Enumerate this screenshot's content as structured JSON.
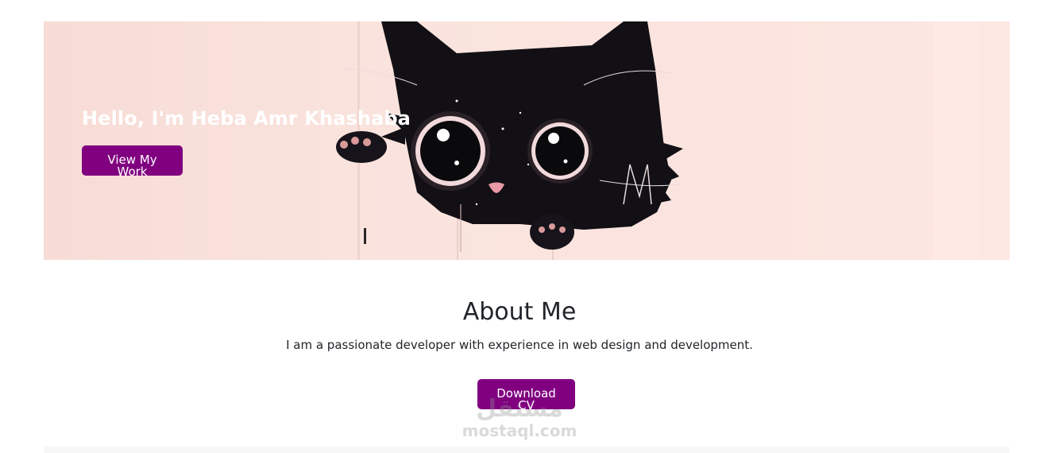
{
  "hero": {
    "title": "Hello, I'm Heba Amr Khashaba",
    "cta_label": "View My Work",
    "illustration": "black-cat-peeking-illustration"
  },
  "about": {
    "heading": "About Me",
    "text": "I am a passionate developer with experience in web design and development.",
    "cv_label": "Download CV"
  },
  "watermark": {
    "arabic": "مستقل",
    "latin": "mostaql.com"
  },
  "colors": {
    "accent": "#800080",
    "hero_bg": "#fbe4df"
  }
}
